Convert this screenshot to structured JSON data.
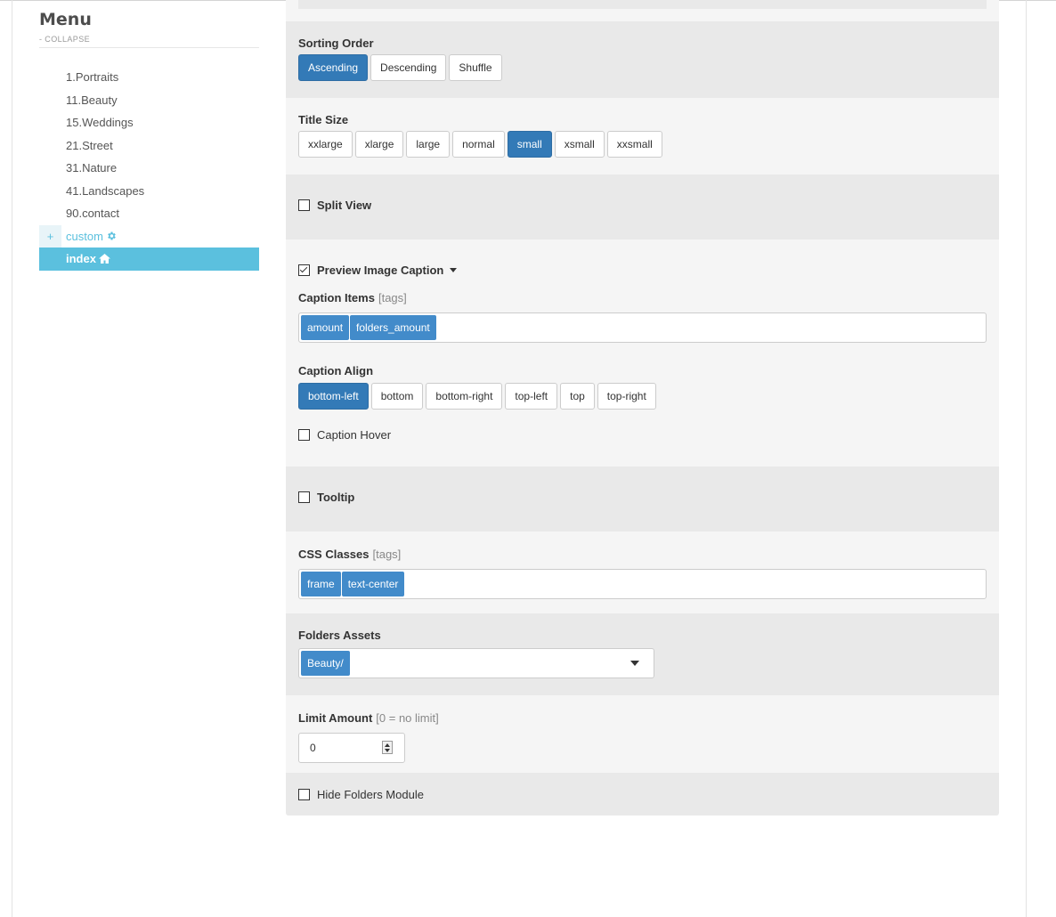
{
  "sidebar": {
    "title": "Menu",
    "collapse_label": "- COLLAPSE",
    "items": [
      {
        "label": "1.Portraits"
      },
      {
        "label": "11.Beauty"
      },
      {
        "label": "15.Weddings"
      },
      {
        "label": "21.Street"
      },
      {
        "label": "31.Nature"
      },
      {
        "label": "41.Landscapes"
      },
      {
        "label": "90.contact"
      },
      {
        "label": "custom",
        "expand": "+",
        "icon": "gear-icon"
      },
      {
        "label": "index",
        "icon": "home-icon",
        "active": true
      }
    ]
  },
  "settings": {
    "sorting_order": {
      "label": "Sorting Order",
      "options": [
        "Ascending",
        "Descending",
        "Shuffle"
      ],
      "selected": "Ascending"
    },
    "title_size": {
      "label": "Title Size",
      "options": [
        "xxlarge",
        "xlarge",
        "large",
        "normal",
        "small",
        "xsmall",
        "xxsmall"
      ],
      "selected": "small"
    },
    "split_view": {
      "label": "Split View",
      "checked": false
    },
    "preview_caption": {
      "label": "Preview Image Caption",
      "checked": true
    },
    "caption_items": {
      "label": "Caption Items",
      "hint": "[tags]",
      "tags": [
        "amount",
        "folders_amount"
      ]
    },
    "caption_align": {
      "label": "Caption Align",
      "options": [
        "bottom-left",
        "bottom",
        "bottom-right",
        "top-left",
        "top",
        "top-right"
      ],
      "selected": "bottom-left"
    },
    "caption_hover": {
      "label": "Caption Hover",
      "checked": false
    },
    "tooltip": {
      "label": "Tooltip",
      "checked": false
    },
    "css_classes": {
      "label": "CSS Classes",
      "hint": "[tags]",
      "tags": [
        "frame",
        "text-center"
      ]
    },
    "folders_assets": {
      "label": "Folders Assets",
      "selected": [
        "Beauty/"
      ]
    },
    "limit_amount": {
      "label": "Limit Amount",
      "hint": "[0 = no limit]",
      "value": "0"
    },
    "hide_folders_module": {
      "label": "Hide Folders Module",
      "checked": false
    }
  },
  "colors": {
    "primary": "#337ab7",
    "tag": "#428bca",
    "accent": "#5bc0de"
  }
}
